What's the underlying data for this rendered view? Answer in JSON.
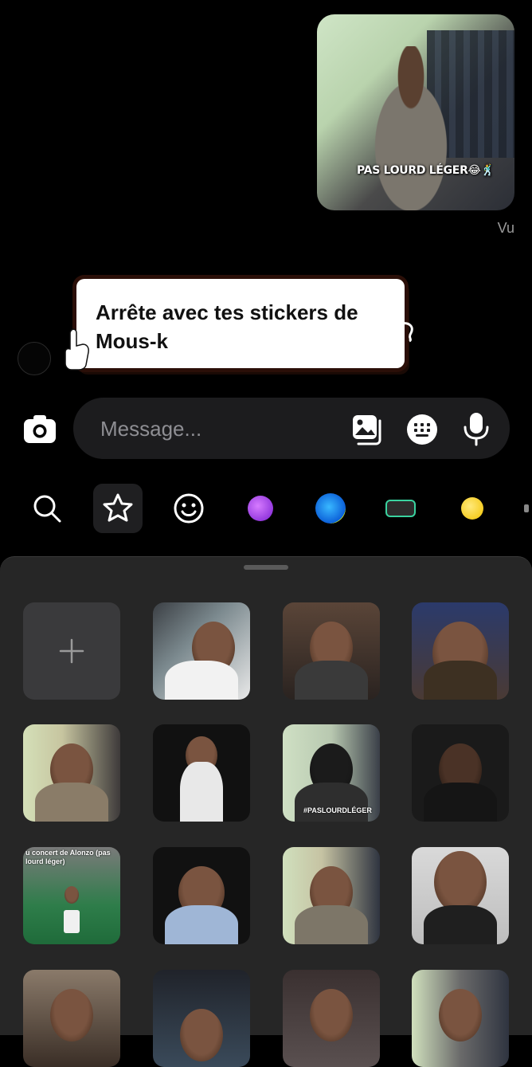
{
  "conversation": {
    "sent_sticker": {
      "caption": "PAS LOURD LÉGER😂🕺"
    },
    "seen_status": "Vu",
    "received_sticker": {
      "text": "Arrête avec tes stickers de Mous-k"
    }
  },
  "composer": {
    "placeholder": "Message...",
    "icons": [
      "camera-icon",
      "gallery-icon",
      "sticker-keyboard-icon",
      "microphone-icon"
    ]
  },
  "tray_tabs": [
    {
      "name": "search",
      "icon": "search-icon"
    },
    {
      "name": "favorites",
      "icon": "star-icon",
      "selected": true
    },
    {
      "name": "emoji",
      "icon": "smiley-icon"
    },
    {
      "name": "pack-1",
      "icon": "purple-creature-icon"
    },
    {
      "name": "pack-2",
      "icon": "blue-creature-icon"
    },
    {
      "name": "pack-3",
      "icon": "green-creature-icon"
    },
    {
      "name": "pack-4",
      "icon": "yellow-duck-icon"
    }
  ],
  "sticker_grid": {
    "add_button_icon": "plus-icon",
    "cells": [
      {
        "kind": "add"
      },
      {
        "kind": "sticker",
        "label": ""
      },
      {
        "kind": "sticker",
        "label": ""
      },
      {
        "kind": "sticker",
        "label": ""
      },
      {
        "kind": "sticker",
        "label": ""
      },
      {
        "kind": "sticker",
        "label": ""
      },
      {
        "kind": "sticker",
        "label": "#PASLOURDLÉGER"
      },
      {
        "kind": "sticker",
        "label": ""
      },
      {
        "kind": "sticker",
        "label": "u concert de Alonzo (pas lourd léger)"
      },
      {
        "kind": "sticker",
        "label": ""
      },
      {
        "kind": "sticker",
        "label": ""
      },
      {
        "kind": "sticker",
        "label": ""
      },
      {
        "kind": "sticker",
        "label": ""
      },
      {
        "kind": "sticker",
        "label": ""
      },
      {
        "kind": "sticker",
        "label": ""
      },
      {
        "kind": "sticker",
        "label": ""
      }
    ]
  },
  "colors": {
    "background": "#000000",
    "composer_bg": "#1c1c1e",
    "panel_bg": "#262626",
    "seen_text": "#9a9a9a"
  }
}
